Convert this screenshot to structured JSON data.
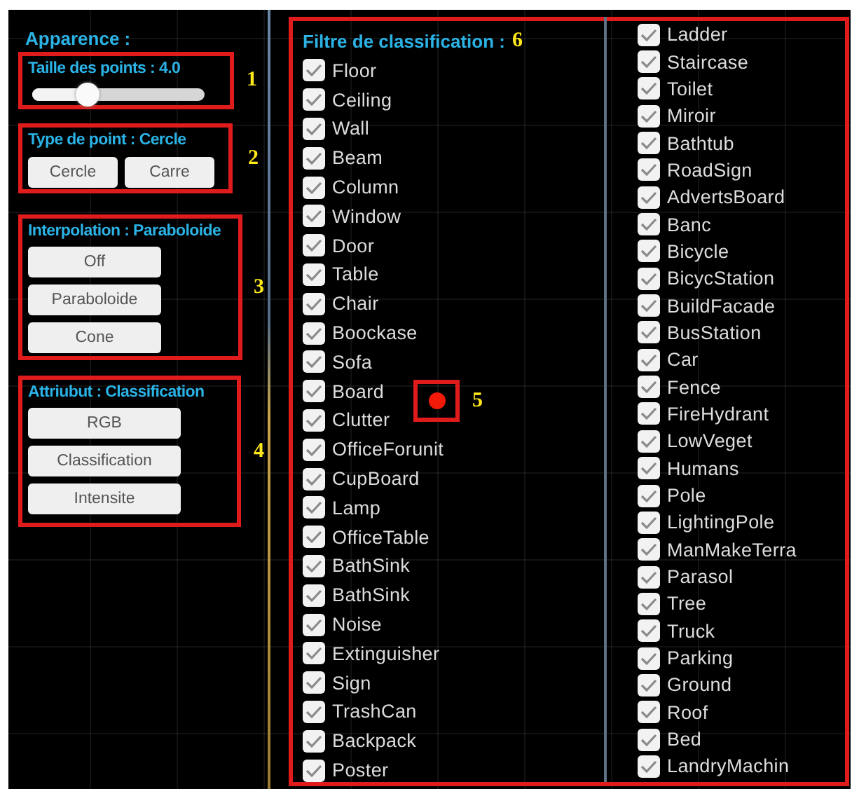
{
  "sidebar": {
    "title": "Apparence :",
    "point_size": {
      "label": "Taille des points : 4.0",
      "level": 0.32,
      "annotation": "1"
    },
    "point_type": {
      "label": "Type de point : Cercle",
      "buttons": [
        "Cercle",
        "Carre"
      ],
      "annotation": "2"
    },
    "interpolation": {
      "label": "Interpolation : Paraboloide",
      "buttons": [
        "Off",
        "Paraboloide",
        "Cone"
      ],
      "annotation": "3"
    },
    "attribute": {
      "label": "Attriubut : Classification",
      "buttons": [
        "RGB",
        "Classification",
        "Intensite"
      ],
      "annotation": "4"
    }
  },
  "point_marker": {
    "annotation": "5"
  },
  "filter": {
    "title": "Filtre de classification :",
    "annotation": "6",
    "columns": [
      [
        {
          "label": "Floor",
          "checked": true
        },
        {
          "label": "Ceiling",
          "checked": true
        },
        {
          "label": "Wall",
          "checked": true
        },
        {
          "label": "Beam",
          "checked": true
        },
        {
          "label": "Column",
          "checked": true
        },
        {
          "label": "Window",
          "checked": true
        },
        {
          "label": "Door",
          "checked": true
        },
        {
          "label": "Table",
          "checked": true
        },
        {
          "label": "Chair",
          "checked": true
        },
        {
          "label": "Boockase",
          "checked": true
        },
        {
          "label": "Sofa",
          "checked": true
        },
        {
          "label": "Board",
          "checked": true
        },
        {
          "label": "Clutter",
          "checked": true
        },
        {
          "label": "OfficeForunit",
          "checked": true
        },
        {
          "label": "CupBoard",
          "checked": true
        },
        {
          "label": "Lamp",
          "checked": true
        },
        {
          "label": "OfficeTable",
          "checked": true
        },
        {
          "label": "BathSink",
          "checked": true
        },
        {
          "label": "BathSink",
          "checked": true
        },
        {
          "label": "Noise",
          "checked": true
        },
        {
          "label": "Extinguisher",
          "checked": true
        },
        {
          "label": "Sign",
          "checked": true
        },
        {
          "label": "TrashCan",
          "checked": true
        },
        {
          "label": "Backpack",
          "checked": true
        },
        {
          "label": "Poster",
          "checked": true
        }
      ],
      [
        {
          "label": "Ladder",
          "checked": true
        },
        {
          "label": "Staircase",
          "checked": true
        },
        {
          "label": "Toilet",
          "checked": true
        },
        {
          "label": "Miroir",
          "checked": true
        },
        {
          "label": "Bathtub",
          "checked": true
        },
        {
          "label": "RoadSign",
          "checked": true
        },
        {
          "label": "AdvertsBoard",
          "checked": true
        },
        {
          "label": "Banc",
          "checked": true
        },
        {
          "label": "Bicycle",
          "checked": true
        },
        {
          "label": "BicycStation",
          "checked": true
        },
        {
          "label": "BuildFacade",
          "checked": true
        },
        {
          "label": "BusStation",
          "checked": true
        },
        {
          "label": "Car",
          "checked": true
        },
        {
          "label": "Fence",
          "checked": true
        },
        {
          "label": "FireHydrant",
          "checked": true
        },
        {
          "label": "LowVeget",
          "checked": true
        },
        {
          "label": "Humans",
          "checked": true
        },
        {
          "label": "Pole",
          "checked": true
        },
        {
          "label": "LightingPole",
          "checked": true
        },
        {
          "label": "ManMakeTerra",
          "checked": true
        },
        {
          "label": "Parasol",
          "checked": true
        },
        {
          "label": "Tree",
          "checked": true
        },
        {
          "label": "Truck",
          "checked": true
        },
        {
          "label": "Parking",
          "checked": true
        },
        {
          "label": "Ground",
          "checked": true
        },
        {
          "label": "Roof",
          "checked": true
        },
        {
          "label": "Bed",
          "checked": true
        },
        {
          "label": "LandryMachin",
          "checked": true
        }
      ]
    ]
  }
}
